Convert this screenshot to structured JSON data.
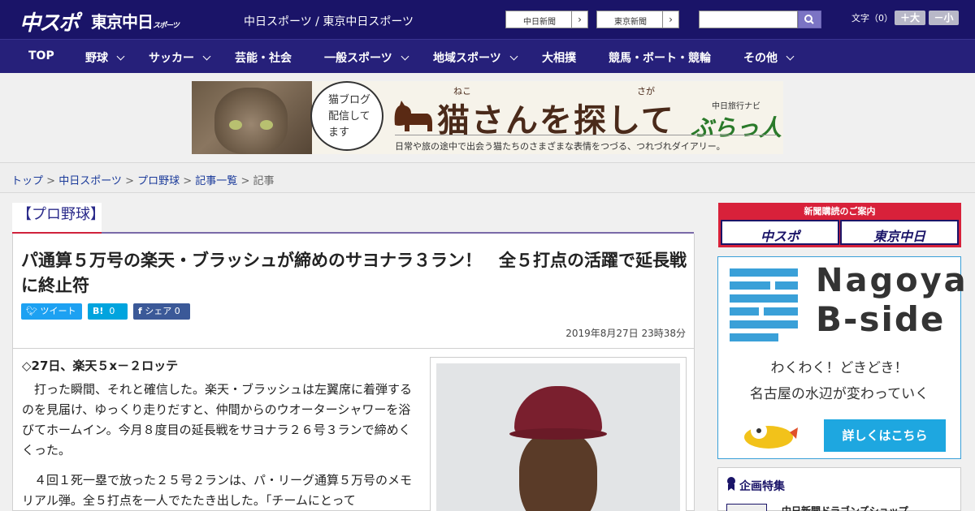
{
  "header": {
    "logo_primary": "中スポ",
    "logo_secondary": "東京中日",
    "logo_secondary_small": "スポーツ",
    "site_name": "中日スポーツ / 東京中日スポーツ",
    "paper_links": [
      "中日新聞",
      "東京新聞"
    ],
    "search_placeholder": "",
    "font_size_label": "文字（0）",
    "size_up": "＋大",
    "size_down": "－小"
  },
  "nav": {
    "items": [
      {
        "label": "TOP",
        "dropdown": false
      },
      {
        "label": "野球",
        "dropdown": true
      },
      {
        "label": "サッカー",
        "dropdown": true
      },
      {
        "label": "芸能・社会",
        "dropdown": false
      },
      {
        "label": "一般スポーツ",
        "dropdown": true
      },
      {
        "label": "地域スポーツ",
        "dropdown": true
      },
      {
        "label": "大相撲",
        "dropdown": false
      },
      {
        "label": "競馬・ボート・競輪",
        "dropdown": false
      },
      {
        "label": "その他",
        "dropdown": true
      }
    ]
  },
  "banner": {
    "speech": "猫ブログ配信してます",
    "ruby_1": "ねこ",
    "ruby_2": "さが",
    "title": "猫さんを探して",
    "nav_sub": "中日旅行ナビ",
    "nav_name": "ぶらっ人",
    "subtitle": "日常や旅の途中で出会う猫たちのさまざまな表情をつづる、つれづれダイアリー。"
  },
  "breadcrumb": {
    "items": [
      "トップ",
      "中日スポーツ",
      "プロ野球",
      "記事一覧"
    ],
    "current": "記事"
  },
  "article": {
    "category": "【プロ野球】",
    "headline": "パ通算５万号の楽天・ブラッシュが締めのサヨナラ３ラン！　全５打点の活躍で延長戦に終止符",
    "share": {
      "tweet": "ツイート",
      "hatena": "B!",
      "hatena_count": "0",
      "facebook": "シェア",
      "facebook_count": "0"
    },
    "date": "2019年8月27日 23時38分",
    "lead": "◇27日、楽天５x－２ロッテ",
    "paragraphs": [
      "　打った瞬間、それと確信した。楽天・ブラッシュは左翼席に着弾するのを見届け、ゆっくり走りだすと、仲間からのウオーターシャワーを浴びてホームイン。今月８度目の延長戦をサヨナラ２６号３ランで締めくくった。",
      "　４回１死一塁で放った２５号２ランは、パ・リーグ通算５万号のメモリアル弾。全５打点を一人でたたき出した。「チームにとって"
    ]
  },
  "sidebar": {
    "subscribe_title": "新聞購読のご案内",
    "subscribe_buttons": [
      "中スポ",
      "東京中日"
    ],
    "nagoya_title_1": "Nagoya",
    "nagoya_title_2": "B-side",
    "nagoya_line_1": "わくわく！どきどき！",
    "nagoya_line_2": "名古屋の水辺が変わっていく",
    "nagoya_cta": "詳しくはこちら",
    "feature_title": "企画特集",
    "feature_item": "中日新聞ドラゴンズショップ"
  },
  "colors": {
    "header_bg": "#1a1468",
    "nav_bg": "#26207a",
    "accent_red": "#d8213a",
    "twitter": "#1da1f2",
    "hatena": "#00a4de",
    "facebook": "#3b5998",
    "nagoya_blue": "#3aa0d8"
  }
}
